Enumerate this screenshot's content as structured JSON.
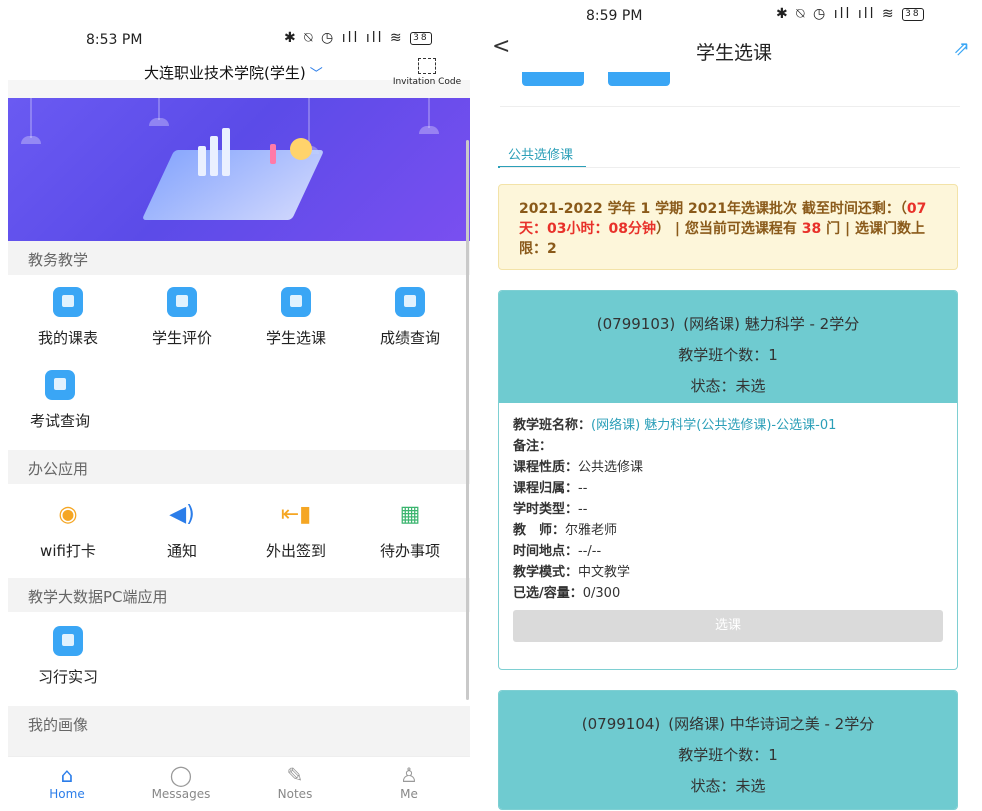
{
  "left": {
    "status": {
      "time": "8:53 PM",
      "icons": "✱ ⍉ ◷ ıll ıll ≋",
      "battery": "38"
    },
    "school": {
      "name": "大连职业技术学院(学生)",
      "chevron": "chevron-down-icon"
    },
    "invitation_label": "Invitation Code",
    "sections": {
      "teaching": "教务教学",
      "office": "办公应用",
      "bigdata": "教学大数据PC端应用",
      "portrait": "我的画像"
    },
    "teaching_apps": [
      "我的课表",
      "学生评价",
      "学生选课",
      "成绩查询",
      "考试查询"
    ],
    "office_apps": [
      {
        "label": "wifi打卡",
        "icon": "wifi-icon",
        "glyph": "◉",
        "color": "#f5a623"
      },
      {
        "label": "通知",
        "icon": "speaker-icon",
        "glyph": "◀)",
        "color": "#2b7de9"
      },
      {
        "label": "外出签到",
        "icon": "door-exit-icon",
        "glyph": "⇤▮",
        "color": "#f5a623"
      },
      {
        "label": "待办事项",
        "icon": "calendar-todo-icon",
        "glyph": "▦",
        "color": "#3bb56f"
      }
    ],
    "bigdata_apps": [
      "习行实习"
    ],
    "tabs": [
      {
        "label": "Home",
        "glyph": "⌂"
      },
      {
        "label": "Messages",
        "glyph": "◯"
      },
      {
        "label": "Notes",
        "glyph": "✎"
      },
      {
        "label": "Me",
        "glyph": "♙"
      }
    ]
  },
  "right": {
    "status": {
      "time": "8:59 PM",
      "icons": "✱ ⍉ ◷ ıll ıll ≋",
      "battery": "38"
    },
    "title": "学生选课",
    "tab": "公共选修课",
    "notice": {
      "p1": "2021-2022 学年 1 学期 2021年选课批次 截至时间还剩：（",
      "remain": "07天：03小时：08分钟",
      "p2": "） | 您当前可选课程有 ",
      "count": "38",
      "p3": " 门 | 选课门数上限：2"
    },
    "courses": [
      {
        "code": "(0799103)",
        "name": "(网络课) 魅力科学 - 2学分",
        "class_count": "教学班个数：1",
        "status": "状态：未选",
        "details": {
          "class_name_k": "教学班名称：",
          "class_name_v": "(网络课) 魅力科学(公共选修课)-公选课-01",
          "note_k": "备注：",
          "nature_k": "课程性质：",
          "nature_v": "公共选修课",
          "belong_k": "课程归属：",
          "belong_v": "--",
          "hours_k": "学时类型：",
          "hours_v": "--",
          "teacher_k": "教　师：",
          "teacher_v": "尔雅老师",
          "place_k": "时间地点：",
          "place_v": "--/--",
          "mode_k": "教学模式：",
          "mode_v": "中文教学",
          "cap_k": "已选/容量：",
          "cap_v": "0/300"
        },
        "button": "选课"
      },
      {
        "code": "(0799104)",
        "name": "(网络课) 中华诗词之美 - 2学分",
        "class_count": "教学班个数：1",
        "status": "状态：未选"
      }
    ]
  }
}
